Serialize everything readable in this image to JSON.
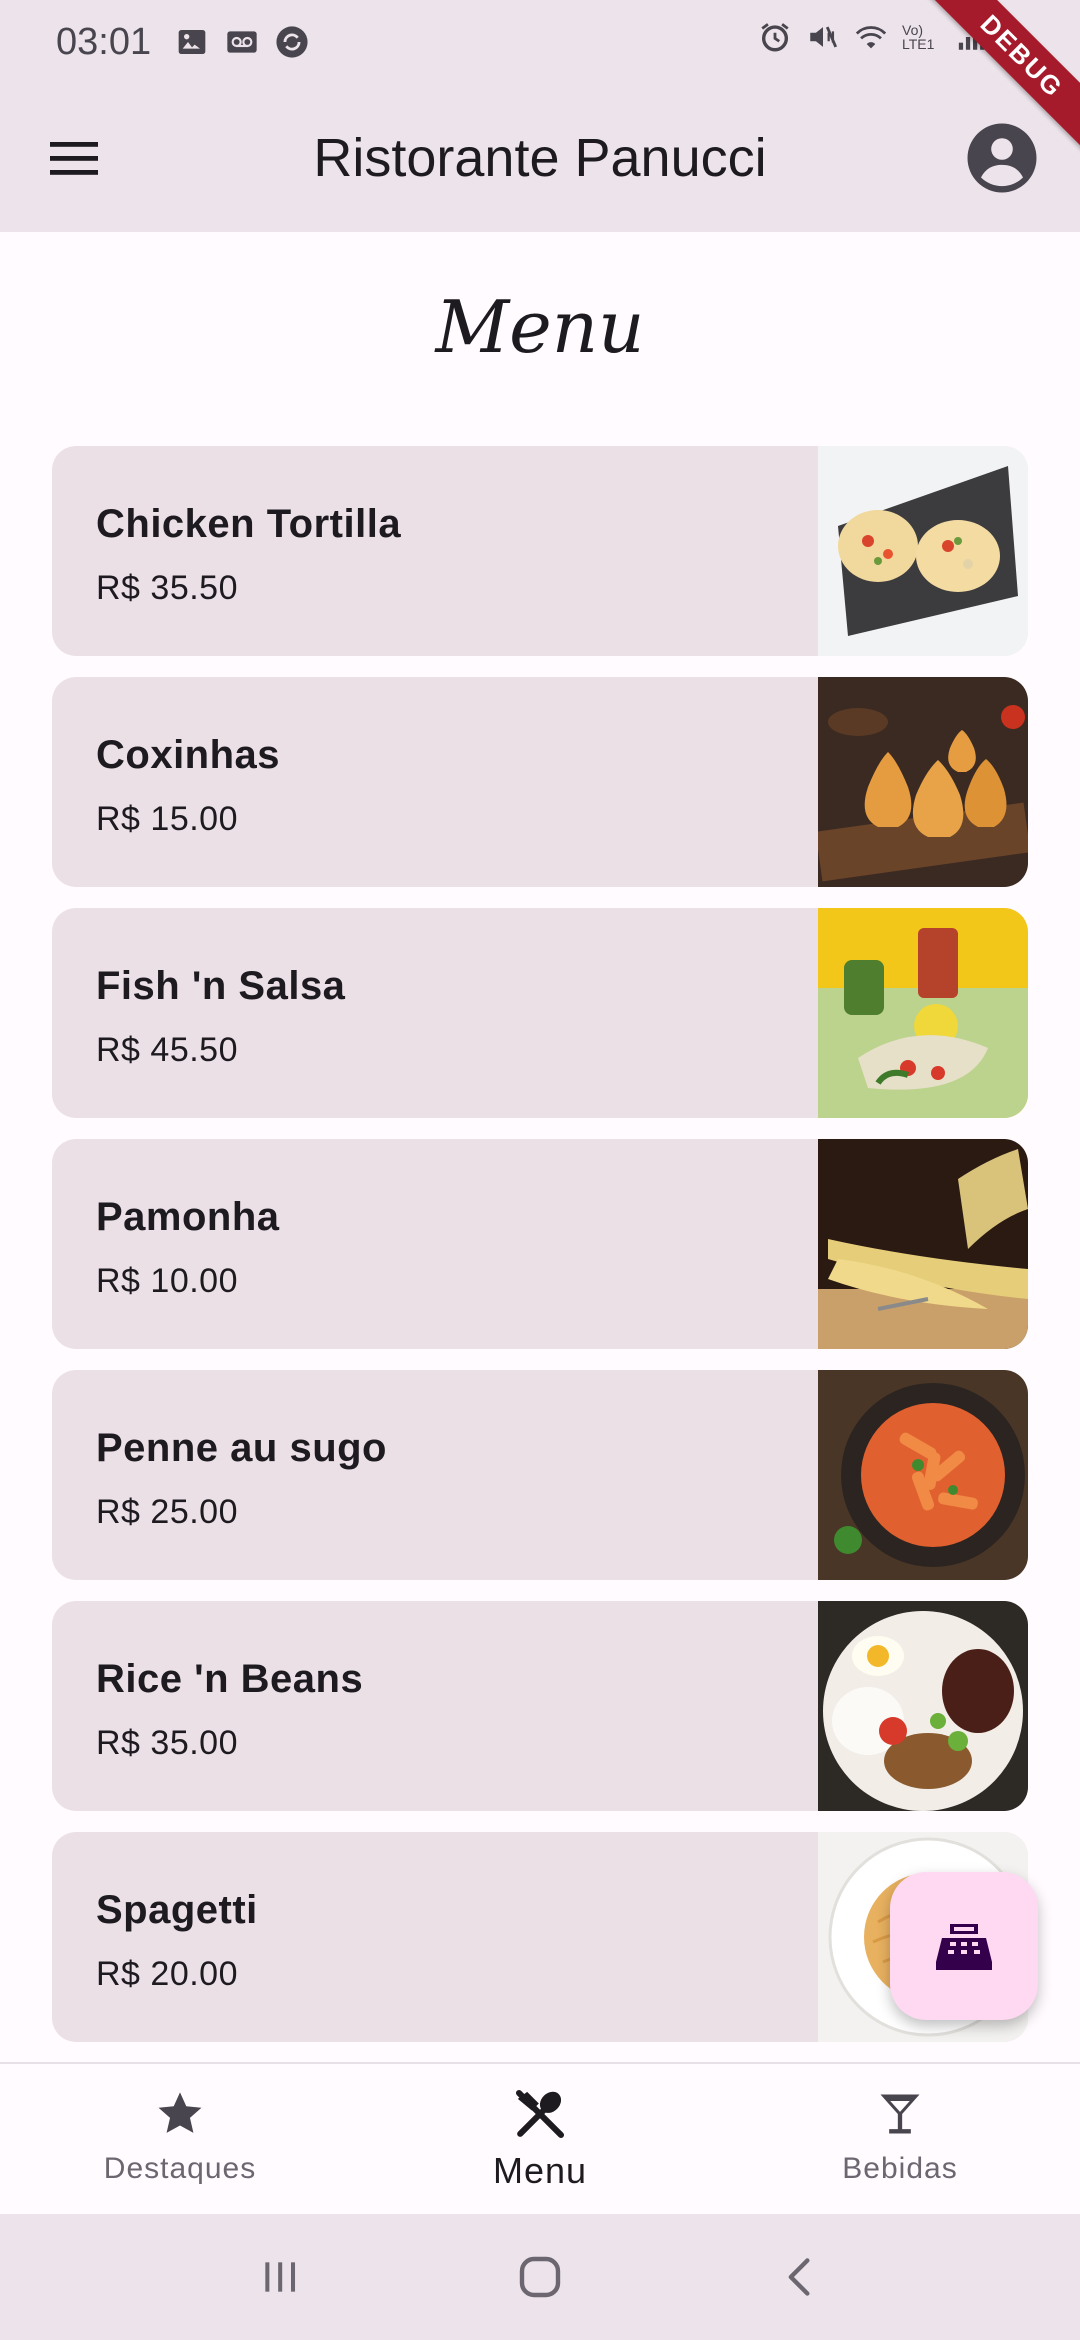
{
  "status_bar": {
    "time": "03:01",
    "debug_label": "DEBUG",
    "network_label": "Vo) LTE1"
  },
  "app_bar": {
    "title": "Ristorante Panucci"
  },
  "page": {
    "title": "Menu"
  },
  "menu_items": [
    {
      "name": "Chicken Tortilla",
      "price": "R$ 35.50"
    },
    {
      "name": "Coxinhas",
      "price": "R$ 15.00"
    },
    {
      "name": "Fish 'n Salsa",
      "price": "R$ 45.50"
    },
    {
      "name": "Pamonha",
      "price": "R$ 10.00"
    },
    {
      "name": "Penne au sugo",
      "price": "R$ 25.00"
    },
    {
      "name": "Rice 'n Beans",
      "price": "R$ 35.00"
    },
    {
      "name": "Spagetti",
      "price": "R$ 20.00"
    }
  ],
  "bottom_nav": {
    "items": [
      {
        "label": "Destaques",
        "icon": "star-icon"
      },
      {
        "label": "Menu",
        "icon": "restaurant-icon"
      },
      {
        "label": "Bebidas",
        "icon": "cocktail-icon"
      }
    ],
    "active_index": 1
  },
  "fab": {
    "icon": "cash-register-icon"
  },
  "colors": {
    "surface": "#ede4eb",
    "card": "#ece0e7",
    "fab": "#ffd8f2",
    "debug": "#a61b2b"
  }
}
